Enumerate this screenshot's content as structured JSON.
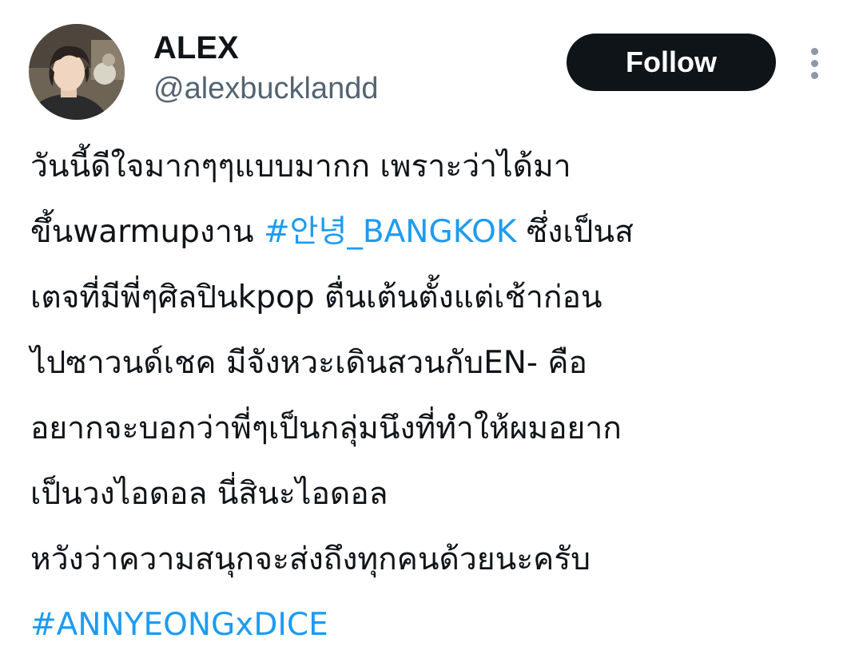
{
  "author": {
    "name": "ALEX",
    "handle": "@alexbucklandd"
  },
  "actions": {
    "follow_label": "Follow",
    "more_icon": "more-vertical-icon"
  },
  "colors": {
    "text": "#0f1419",
    "secondary": "#536471",
    "link": "#1d9bf0",
    "button_bg": "#0f1419"
  },
  "tweet": {
    "line1": "วันนี้ดีใจมากๆๆแบบมากก เพราะว่าได้มา",
    "line2_pre": "ขึ้นwarmupงาน ",
    "hashtag1": "#안녕_BANGKOK",
    "line2_post": " ซึ่งเป็นส",
    "line3": "เตจที่มีพี่ๆศิลปินkpop ตื่นเต้นตั้งแต่เช้าก่อน",
    "line4": "ไปซาวนด์เชค มีจังหวะเดินสวนกับEN- คือ",
    "line5": "อยากจะบอกว่าพี่ๆเป็นกลุ่มนึงที่ทำให้ผมอยาก",
    "line6": "เป็นวงไอดอล นี่สินะไอดอล",
    "line7": "หวังว่าความสนุกจะส่งถึงทุกคนด้วยนะครับ",
    "hashtag2": "#ANNYEONGxDICE"
  }
}
